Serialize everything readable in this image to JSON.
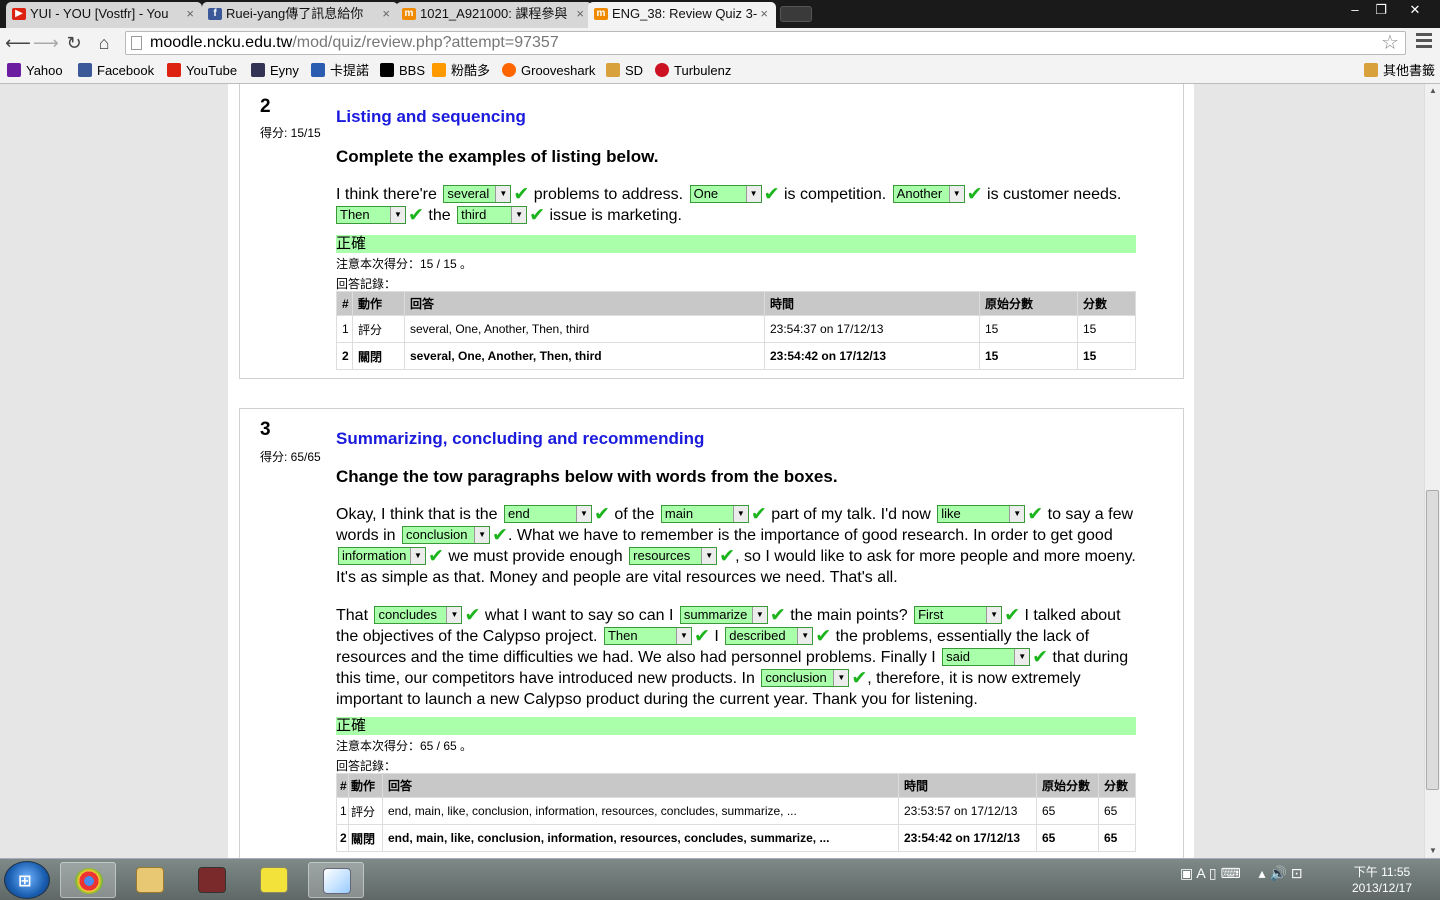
{
  "browser": {
    "tabs": [
      {
        "title": "YUI - YOU [Vostfr] - You",
        "icon": "youtube-icon"
      },
      {
        "title": "Ruei-yang傳了訊息給你",
        "icon": "facebook-icon"
      },
      {
        "title": "1021_A921000: 課程參與",
        "icon": "moodle-icon"
      },
      {
        "title": "ENG_38: Review Quiz 3-",
        "icon": "moodle-icon"
      }
    ],
    "url_host": "moodle.ncku.edu.tw",
    "url_path": "/mod/quiz/review.php?attempt=97357",
    "window_buttons": [
      "–",
      "❐",
      "✕"
    ]
  },
  "bookmarks": [
    {
      "label": "Yahoo",
      "color": "#6b1fa0"
    },
    {
      "label": "Facebook",
      "color": "#3b5998"
    },
    {
      "label": "YouTube",
      "color": "#d21"
    },
    {
      "label": "Eyny",
      "color": "#335"
    },
    {
      "label": "卡提諾",
      "color": "#2a5db0"
    },
    {
      "label": "BBS",
      "color": "#000"
    },
    {
      "label": "粉酷多",
      "color": "#f90"
    },
    {
      "label": "Grooveshark",
      "color": "#f60"
    },
    {
      "label": "SD",
      "color": "#d9a13b"
    },
    {
      "label": "Turbulenz",
      "color": "#c12"
    }
  ],
  "other_bookmarks": "其他書籤",
  "q2": {
    "number": "2",
    "score": "得分: 15/15",
    "title": "Listing and sequencing",
    "prompt": "Complete the examples of listing below.",
    "t1": "I think there're",
    "s1": "several",
    "t2": "problems to address.",
    "s2": "One",
    "t3": "is competition.",
    "s3": "Another",
    "t4": "is customer needs.",
    "s4": "Then",
    "t5": "the",
    "s5": "third",
    "t6": "issue is marketing.",
    "correct": "正確",
    "mark_note": "注意本次得分：15 / 15 。",
    "history_label": "回答記錄：",
    "headers": [
      "#",
      "動作",
      "回答",
      "時間",
      "原始分數",
      "分數"
    ],
    "rows": [
      [
        "1",
        "評分",
        "several, One, Another, Then, third",
        "23:54:37 on 17/12/13",
        "15",
        "15"
      ],
      [
        "2",
        "關閉",
        "several, One, Another, Then, third",
        "23:54:42 on 17/12/13",
        "15",
        "15"
      ]
    ]
  },
  "q3": {
    "number": "3",
    "score": "得分: 65/65",
    "title": "Summarizing, concluding and recommending",
    "prompt": "Change the tow paragraphs below with words from the boxes.",
    "p1": {
      "a": "Okay, I think that is the",
      "s1": "end",
      "b": "of the",
      "s2": "main",
      "c": "part of my talk. I'd now",
      "s3": "like",
      "d": "to say a few words in",
      "s4": "conclusion",
      "e": ". What we have to remember is the importance of good research. In order to get good",
      "s5": "information",
      "f": "we must provide enough",
      "s6": "resources",
      "g": ", so I would like to ask for more people and more moeny. It's as simple as that. Money and people are vital resources we need. That's all."
    },
    "p2": {
      "a": "That",
      "s1": "concludes",
      "b": "what I want to say so can I",
      "s2": "summarize",
      "c": "the main points?",
      "s3": "First",
      "d": "I talked about the objectives of the Calypso project.",
      "s4": "Then",
      "e": "I",
      "s5": "described",
      "f": "the problems, essentially the lack of resources and the time difficulties we had. We also had personnel problems. Finally I",
      "s6": "said",
      "g": "that during this time, our competitors have introduced new products. In",
      "s7": "conclusion",
      "h": ", therefore, it is now extremely important to launch a new Calypso product during the current year. Thank you for listening."
    },
    "correct": "正確",
    "mark_note": "注意本次得分：65 / 65 。",
    "history_label": "回答記錄：",
    "headers": [
      "#",
      "動作",
      "回答",
      "時間",
      "原始分數",
      "分數"
    ],
    "rows": [
      [
        "1",
        "評分",
        "end, main, like, conclusion, information, resources, concludes, summarize, ...",
        "23:53:57 on 17/12/13",
        "65",
        "65"
      ],
      [
        "2",
        "關閉",
        "end, main, like, conclusion, information, resources, concludes, summarize, ...",
        "23:54:42 on 17/12/13",
        "65",
        "65"
      ]
    ]
  },
  "taskbar": {
    "time": "下午 11:55",
    "date": "2013/12/17"
  }
}
